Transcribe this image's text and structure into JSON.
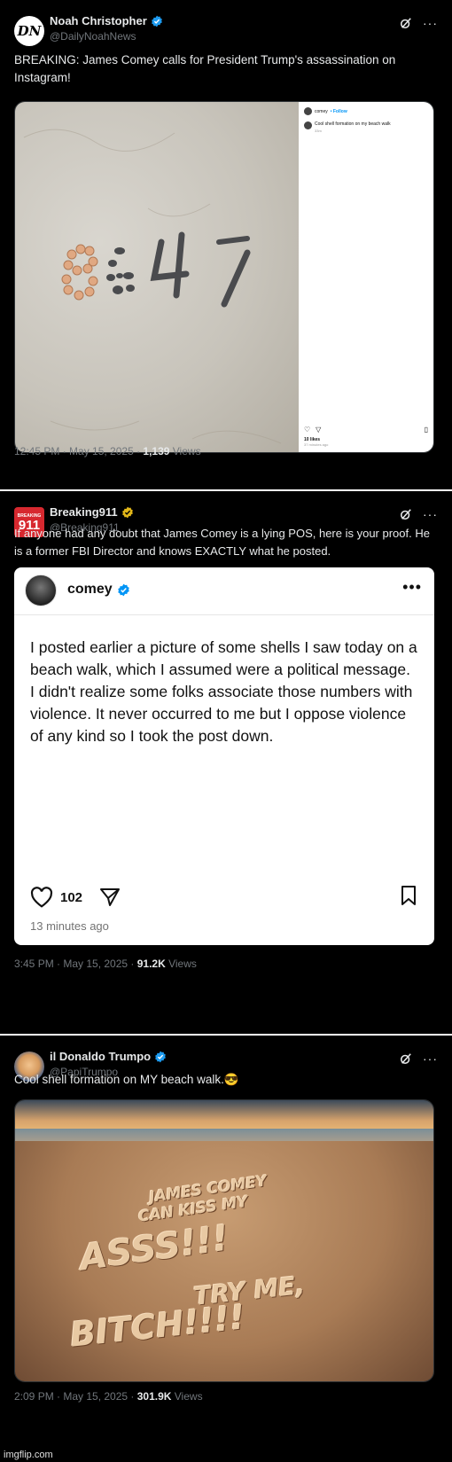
{
  "tweets": [
    {
      "display_name": "Noah Christopher",
      "handle": "@DailyNoahNews",
      "avatar_text": "DN",
      "text": "BREAKING: James Comey calls for President Trump's assassination on Instagram!",
      "time": "12:45 PM · May 15, 2025 · ",
      "views": "1,139",
      "views_label": " Views",
      "media": {
        "sand_number": "8647",
        "ig_username": "comey",
        "ig_follow": "• Follow",
        "ig_caption": "Cool shell formation on my beach walk",
        "ig_caption_time": "33m",
        "ig_likes": "10 likes",
        "ig_time": "37 minutes ago"
      }
    },
    {
      "display_name": "Breaking911",
      "handle": "@Breaking911",
      "avatar_text": "911",
      "avatar_top_text": "BREAKING",
      "text": "If anyone had any doubt that James Comey is a lying POS, here is your proof. He is a former FBI Director and knows EXACTLY what he posted.",
      "time": "3:45 PM · May 15, 2025 · ",
      "views": "91.2K",
      "views_label": " Views",
      "card": {
        "username": "comey",
        "body": "I posted earlier a picture of some shells I saw today on a beach walk, which I assumed were a political message. I didn't realize some folks associate those numbers with violence. It never occurred to me but I oppose violence of any kind so I took the post down.",
        "likes": "102",
        "time": "13 minutes ago"
      }
    },
    {
      "display_name": "il Donaldo Trumpo",
      "handle": "@PapiTrumpo",
      "text": "Cool shell formation on MY beach walk.😎",
      "time": "2:09 PM · May 15, 2025 · ",
      "views": "301.9K",
      "views_label": " Views",
      "media": {
        "line1": "JAMES COMEY",
        "line2": "CAN KISS MY",
        "line3": "ASSS!!!",
        "line4": "TRY ME,",
        "line5": "BITCH!!!!"
      }
    }
  ],
  "footer": "imgflip.com",
  "colors": {
    "background": "#000000",
    "text": "#e7e9ea",
    "muted": "#71767b",
    "verified": "#1d9bf0",
    "gold_verified": "#e2b719",
    "breaking911_red": "#d7282f"
  }
}
